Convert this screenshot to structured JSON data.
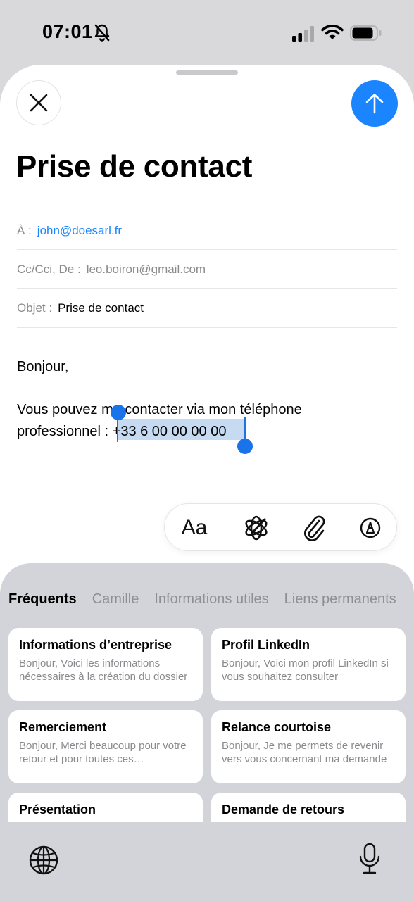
{
  "status_bar": {
    "time": "07:01"
  },
  "compose": {
    "title": "Prise de contact",
    "to_label": "À :",
    "to_value": "john@doesarl.fr",
    "cc_label": "Cc/Cci, De :",
    "cc_value": "leo.boiron@gmail.com",
    "subject_label": "Objet :",
    "subject_value": "Prise de contact",
    "body_greeting": "Bonjour,",
    "body_line1": "Vous pouvez me contacter via mon téléphone",
    "body_line2_prefix": "professionnel : ",
    "body_phone": "+33 6 00 00 00 00"
  },
  "toolbar": {
    "format_label": "Aa"
  },
  "suggestions": {
    "tabs": [
      {
        "label": "Fréquents"
      },
      {
        "label": "Camille"
      },
      {
        "label": "Informations utiles"
      },
      {
        "label": "Liens permanents"
      }
    ],
    "cards": [
      {
        "title": "Informations d’entreprise",
        "preview": "Bonjour,  Voici les informations nécessaires à la création du dossier"
      },
      {
        "title": "Profil LinkedIn",
        "preview": "Bonjour,  Voici mon profil LinkedIn si vous souhaitez consulter"
      },
      {
        "title": "Remerciement",
        "preview": "Bonjour,  Merci beaucoup pour votre retour et pour toutes ces informations"
      },
      {
        "title": "Relance courtoise",
        "preview": "Bonjour,  Je me permets de revenir vers vous concernant ma demande"
      },
      {
        "title": "Présentation",
        "preview": ""
      },
      {
        "title": "Demande de retours",
        "preview": ""
      }
    ]
  },
  "colors": {
    "accent": "#1a85ff",
    "selection": "#c6daf2"
  }
}
